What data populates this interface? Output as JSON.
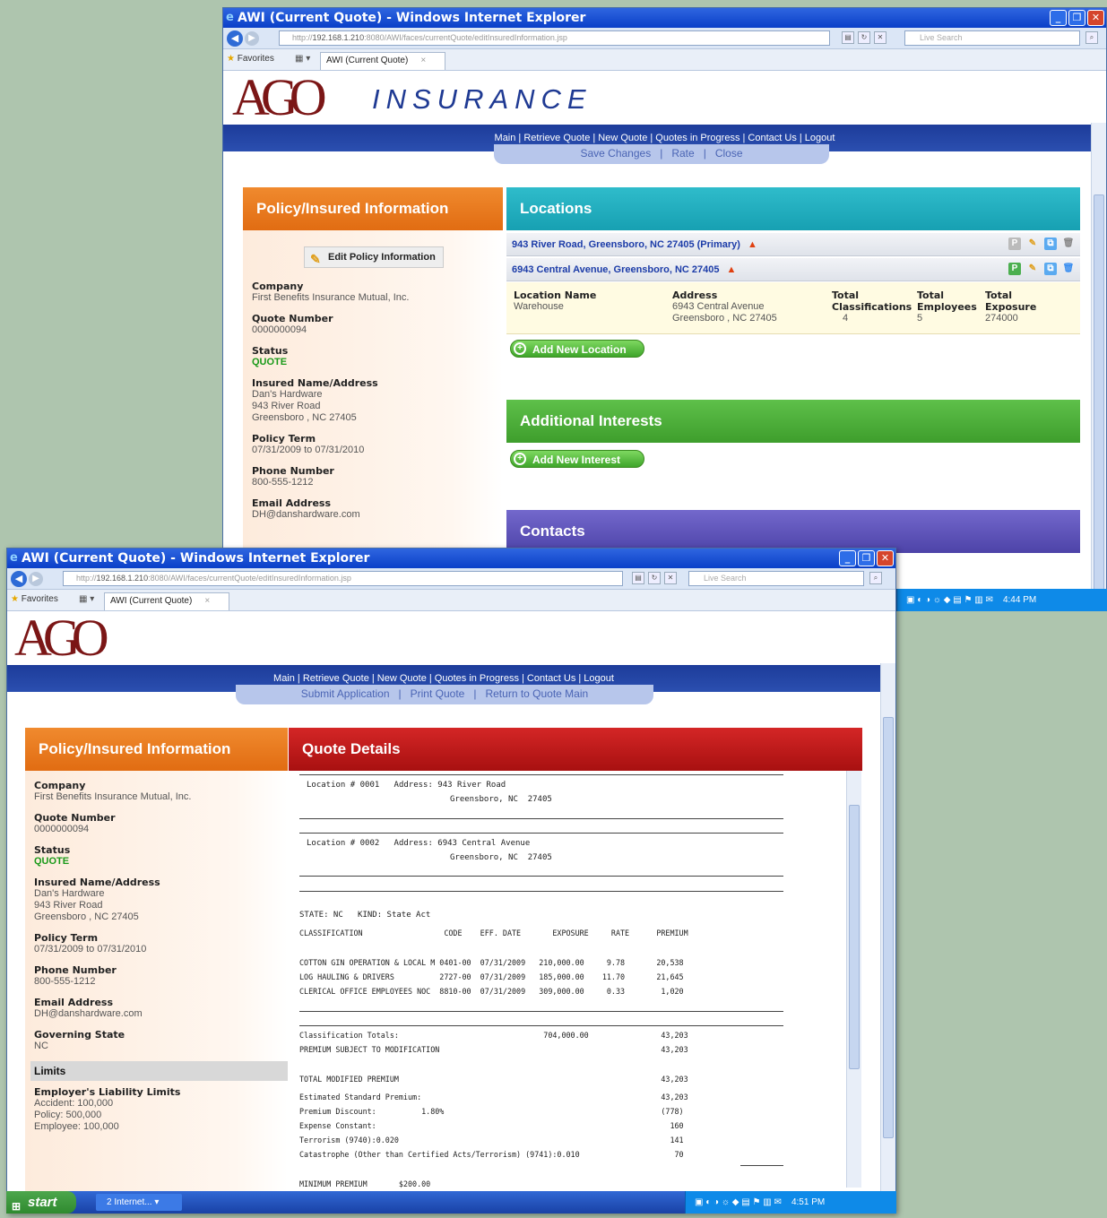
{
  "colors": {
    "orange": "#e87a20",
    "teal": "#1aa8b8",
    "green": "#4fae38",
    "purple": "#5a4fb8",
    "red": "#c41e1e",
    "navy": "#1f3a93"
  },
  "back_window": {
    "title": "AWI (Current Quote) - Windows Internet Explorer",
    "url_prefix": "http://",
    "url_host": "192.168.1.210",
    "url_path": ":8080/AWI/faces/currentQuote/editInsuredInformation.jsp",
    "search_placeholder": "Live Search",
    "favorites": "Favorites",
    "tab_label": "AWI (Current Quote)",
    "brand": "INSURANCE",
    "logo": "AGO",
    "nav": "Main | Retrieve Quote | New Quote | Quotes in Progress | Contact Us | Logout",
    "subnav": {
      "save": "Save Changes",
      "rate": "Rate",
      "close": "Close"
    },
    "left_title": "Policy/Insured Information",
    "edit_label": "Edit Policy Information",
    "fields": [
      {
        "label": "Company",
        "value": "First Benefits Insurance Mutual, Inc."
      },
      {
        "label": "Quote Number",
        "value": "0000000094"
      },
      {
        "label": "Status",
        "value": "QUOTE"
      },
      {
        "label": "Insured Name/Address",
        "value": "Dan's Hardware",
        "value2": "943 River Road",
        "value3": "Greensboro ,  NC  27405"
      },
      {
        "label": "Policy Term",
        "value": "07/31/2009 to 07/31/2010"
      },
      {
        "label": "Phone Number",
        "value": "800-555-1212"
      },
      {
        "label": "Email Address",
        "value": "DH@danshardware.com"
      }
    ],
    "locations_title": "Locations",
    "locations": [
      {
        "text": "943 River Road, Greensboro, NC 27405 (Primary)"
      },
      {
        "text": "6943 Central Avenue, Greensboro, NC 27405"
      }
    ],
    "detail": {
      "loc_name_label": "Location Name",
      "loc_name": "Warehouse",
      "address_label": "Address",
      "address1": "6943 Central Avenue",
      "address2": "Greensboro ,  NC 27405",
      "tc_label1": "Total",
      "tc_label2": "Classifications",
      "tc": "4",
      "te_label1": "Total",
      "te_label2": "Employees",
      "te": "5",
      "tx_label1": "Total",
      "tx_label2": "Exposure",
      "tx": "274000"
    },
    "add_location": "Add New Location",
    "interests_title": "Additional Interests",
    "add_interest": "Add New Interest",
    "contacts_title": "Contacts",
    "tray_time": "4:44 PM"
  },
  "front_window": {
    "title": "AWI (Current Quote) - Windows Internet Explorer",
    "url_prefix": "http://",
    "url_host": "192.168.1.210",
    "url_path": ":8080/AWI/faces/currentQuote/editInsuredInformation.jsp",
    "search_placeholder": "Live Search",
    "favorites": "Favorites",
    "tab_label": "AWI (Current Quote)",
    "logo": "AGO",
    "nav": "Main | Retrieve Quote | New Quote | Quotes in Progress | Contact Us | Logout",
    "subnav": {
      "submit": "Submit Application",
      "print": "Print Quote",
      "return": "Return to Quote Main"
    },
    "left_title": "Policy/Insured Information",
    "fields": [
      {
        "label": "Company",
        "value": "First Benefits Insurance Mutual, Inc."
      },
      {
        "label": "Quote Number",
        "value": "0000000094"
      },
      {
        "label": "Status",
        "value": "QUOTE"
      },
      {
        "label": "Insured Name/Address",
        "value": "Dan's Hardware",
        "value2": "943 River Road",
        "value3": "Greensboro ,  NC  27405"
      },
      {
        "label": "Policy Term",
        "value": "07/31/2009 to 07/31/2010"
      },
      {
        "label": "Phone Number",
        "value": "800-555-1212"
      },
      {
        "label": "Email Address",
        "value": "DH@danshardware.com"
      },
      {
        "label": "Governing State",
        "value": "NC"
      }
    ],
    "limits_title": "Limits",
    "limits": {
      "label": "Employer's Liability Limits",
      "accident": "Accident: 100,000",
      "policy": "Policy: 500,000",
      "employee": "Employee: 100,000"
    },
    "quote_title": "Quote Details",
    "quote_lines": {
      "loc1a": "Location # 0001   Address: 943 River Road",
      "loc1b": "Greensboro, NC  27405",
      "loc2a": "Location # 0002   Address: 6943 Central Avenue",
      "loc2b": "Greensboro, NC  27405",
      "state": "STATE: NC   KIND: State Act",
      "hdr": "CLASSIFICATION                  CODE    EFF. DATE       EXPOSURE     RATE      PREMIUM",
      "r1": "COTTON GIN OPERATION & LOCAL M 0401-00  07/31/2009   210,000.00     9.78       20,538",
      "r2": "LOG HAULING & DRIVERS          2727-00  07/31/2009   185,000.00    11.70       21,645",
      "r3": "CLERICAL OFFICE EMPLOYEES NOC  8810-00  07/31/2009   309,000.00     0.33        1,020",
      "t1": "Classification Totals:                                704,000.00                43,203",
      "t2": "PREMIUM SUBJECT TO MODIFICATION                                                 43,203",
      "t3": "TOTAL MODIFIED PREMIUM                                                          43,203",
      "t4": "Estimated Standard Premium:                                                     43,203",
      "t5": "Premium Discount:          1.80%                                                (778)",
      "t6": "Expense Constant:                                                                 160",
      "t7": "Terrorism (9740):0.020                                                            141",
      "t8": "Catastrophe (Other than Certified Acts/Terrorism) (9741):0.010                     70",
      "t9": "MINIMUM PREMIUM       $200.00"
    },
    "start": "start",
    "task": "2 Internet...",
    "tray_time": "4:51 PM"
  }
}
